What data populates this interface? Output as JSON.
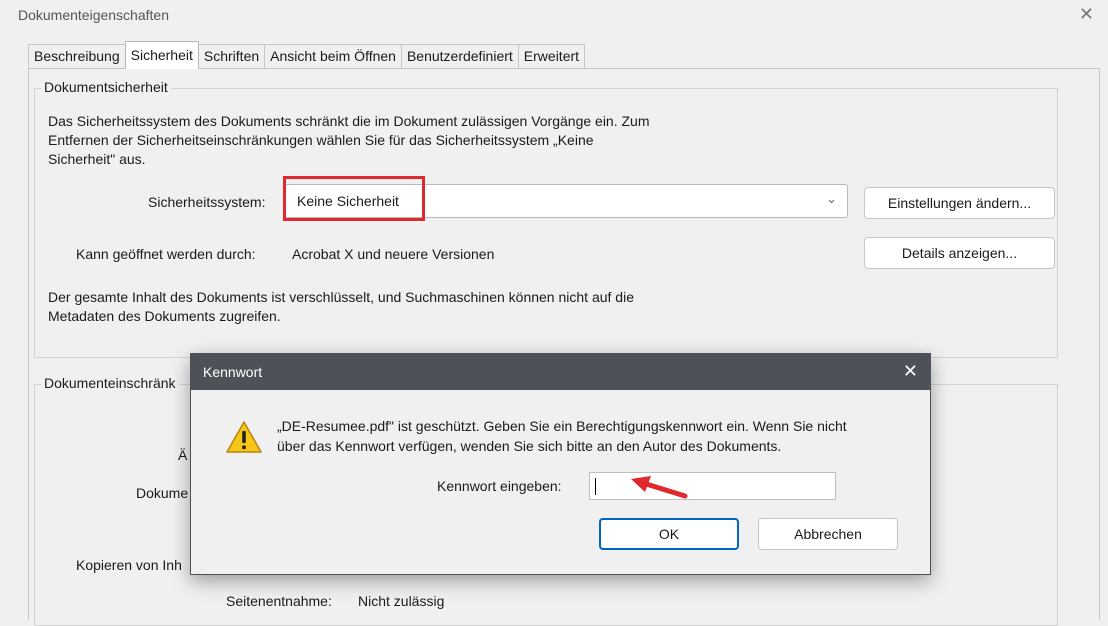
{
  "window": {
    "title": "Dokumenteigenschaften",
    "close": "✕"
  },
  "tabs": [
    "Beschreibung",
    "Sicherheit",
    "Schriften",
    "Ansicht beim Öffnen",
    "Benutzerdefiniert",
    "Erweitert"
  ],
  "security_group": {
    "title": "Dokumentsicherheit",
    "description_lines": [
      "Das Sicherheitssystem des Dokuments schränkt die im Dokument zulässigen Vorgänge ein. Zum",
      "Entfernen der Sicherheitseinschränkungen wählen Sie für das Sicherheitssystem „Keine",
      "Sicherheit\" aus."
    ],
    "system_label": "Sicherheitssystem:",
    "system_value": "Keine Sicherheit",
    "change_settings_button": "Einstellungen ändern...",
    "opened_by_label": "Kann geöffnet werden durch:",
    "opened_by_value": "Acrobat X und neuere Versionen",
    "details_button": "Details anzeigen...",
    "encryption_lines": [
      "Der gesamte Inhalt des Dokuments ist verschlüsselt, und Suchmaschinen können nicht auf die",
      "Metadaten des Dokuments zugreifen."
    ]
  },
  "restrictions_group": {
    "title_partial": "Dokumenteinschränk",
    "row_partial_1": "Ä",
    "row_partial_2": "Dokume",
    "row_partial_3": "Kopieren von Inh",
    "page_extraction_label": "Seitenentnahme:",
    "page_extraction_value": "Nicht zulässig"
  },
  "dialog": {
    "title": "Kennwort",
    "close": "✕",
    "message_lines": [
      "„DE-Resumee.pdf\" ist geschützt. Geben Sie ein Berechtigungskennwort ein. Wenn Sie nicht",
      "über das Kennwort verfügen, wenden Sie sich bitte an den Autor des Dokuments."
    ],
    "password_label": "Kennwort eingeben:",
    "password_value": "",
    "ok_button": "OK",
    "cancel_button": "Abbrechen"
  },
  "colors": {
    "highlight": "#e0282f",
    "dialog_titlebar": "#4d5258",
    "ok_border": "#0067c0",
    "warning_yellow": "#f5c518"
  }
}
